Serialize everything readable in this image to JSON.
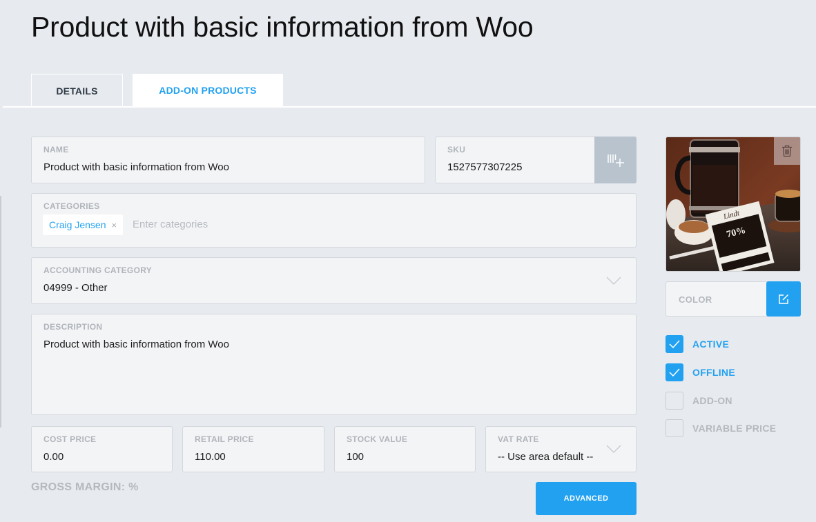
{
  "page": {
    "title": "Product with basic information from Woo"
  },
  "tabs": [
    {
      "label": "DETAILS",
      "active": false
    },
    {
      "label": "ADD-ON PRODUCTS",
      "active": true
    }
  ],
  "form": {
    "name": {
      "label": "NAME",
      "value": "Product with basic information from Woo"
    },
    "sku": {
      "label": "SKU",
      "value": "1527577307225",
      "generate_icon": "barcode-add-icon"
    },
    "categories": {
      "label": "CATEGORIES",
      "chips": [
        {
          "label": "Craig Jensen",
          "remove": "×"
        }
      ],
      "placeholder": "Enter categories"
    },
    "accounting_category": {
      "label": "ACCOUNTING CATEGORY",
      "value": "04999 - Other"
    },
    "description": {
      "label": "DESCRIPTION",
      "value": "Product with basic information from Woo"
    },
    "cost_price": {
      "label": "COST PRICE",
      "value": "0.00"
    },
    "retail_price": {
      "label": "RETAIL PRICE",
      "value": "110.00"
    },
    "stock_value": {
      "label": "STOCK VALUE",
      "value": "100"
    },
    "vat_rate": {
      "label": "VAT RATE",
      "value": "-- Use area default --"
    },
    "gross_margin": "GROSS MARGIN: %",
    "advanced_label": "ADVANCED"
  },
  "sidebar": {
    "image": {
      "alt": "Coffee press with chocolate bar",
      "delete_icon": "trash-icon"
    },
    "color": {
      "label": "COLOR",
      "edit_icon": "edit-icon"
    },
    "checkboxes": [
      {
        "label": "ACTIVE",
        "checked": true
      },
      {
        "label": "OFFLINE",
        "checked": true
      },
      {
        "label": "ADD-ON",
        "checked": false
      },
      {
        "label": "VARIABLE PRICE",
        "checked": false
      }
    ]
  },
  "colors": {
    "accent": "#22a1f1",
    "background": "#e7eaef",
    "field_bg": "#f3f4f6",
    "label_gray": "#b0b4ba"
  }
}
